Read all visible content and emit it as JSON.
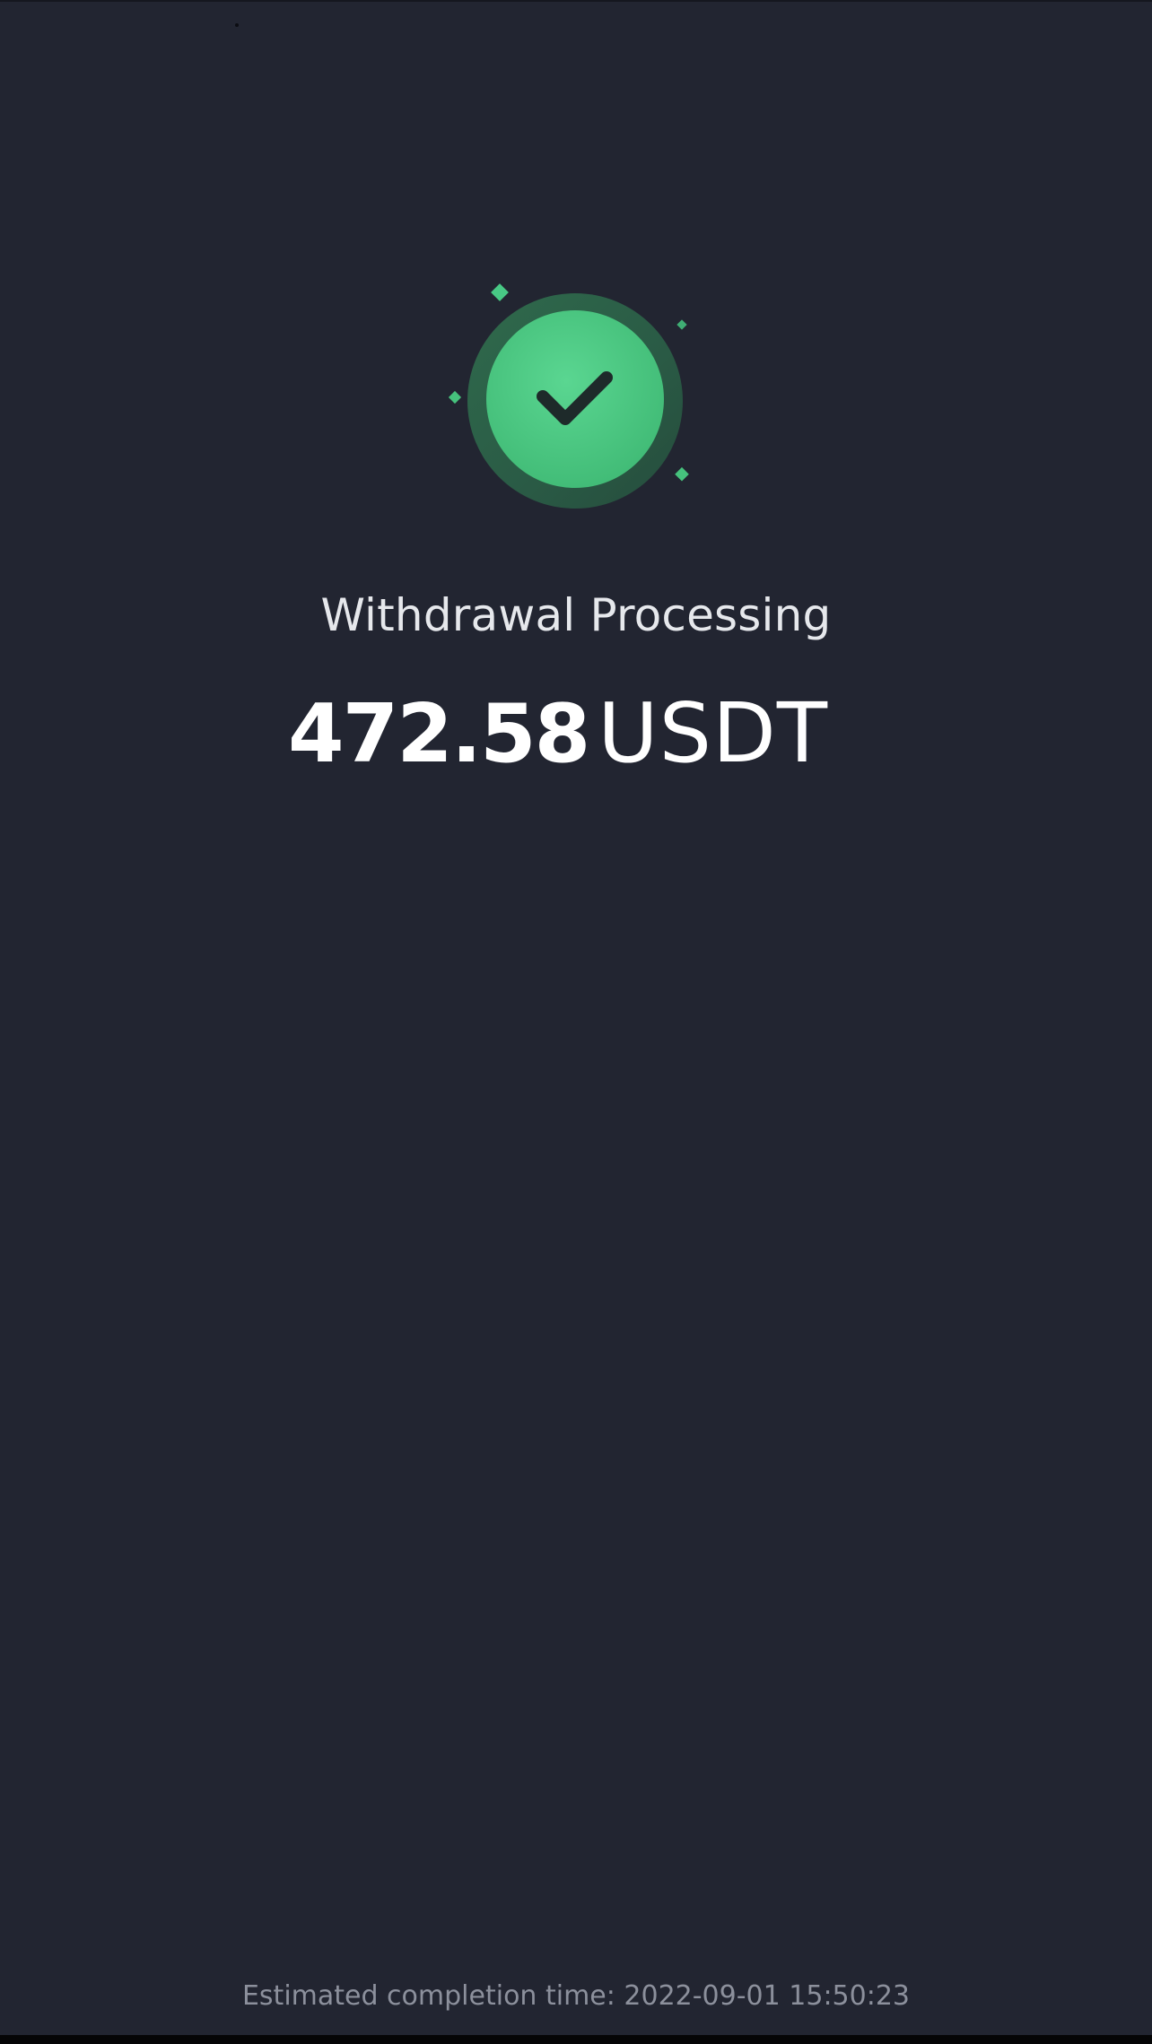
{
  "status": {
    "title": "Withdrawal Processing",
    "icon": "check-circle-icon"
  },
  "amount": {
    "value": "472.58",
    "unit": "USDT"
  },
  "footer": {
    "note": "Estimated completion time: 2022-09-01 15:50:23"
  },
  "colors": {
    "background": "#222531",
    "accent": "#46c27d",
    "text_primary": "#ffffff",
    "text_secondary": "#8c909c"
  }
}
